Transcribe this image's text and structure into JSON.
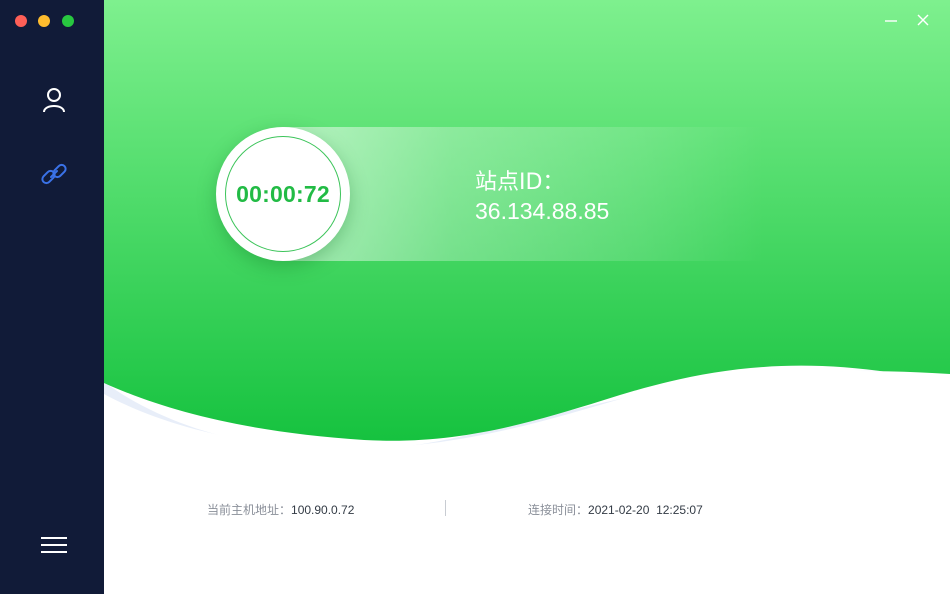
{
  "window": {
    "traffic_lights": {
      "close": "#fe5f57",
      "minimize": "#febc2e",
      "zoom": "#28c840"
    },
    "controls": [
      {
        "name": "minimize",
        "icon": "minimize-icon",
        "glyph": "—"
      },
      {
        "name": "close",
        "icon": "close-icon",
        "glyph": "✕"
      }
    ]
  },
  "sidebar": {
    "background": "#111b38",
    "items": [
      {
        "id": "profile",
        "icon": "user-icon",
        "active": false
      },
      {
        "id": "connection",
        "icon": "link-icon",
        "active": true
      }
    ],
    "menu_icon": "hamburger-menu-icon"
  },
  "theme": {
    "accent": "#22bb45",
    "gradient_top": "#7ef08e",
    "gradient_bottom": "#16c23f",
    "active_icon": "#3a72e8"
  },
  "timer": {
    "value": "00:00:72"
  },
  "site": {
    "label": "站点ID：",
    "value": "36.134.88.85"
  },
  "info": {
    "host_label": "当前主机地址：",
    "host_value": "100.90.0.72",
    "time_label": "连接时间：",
    "time_value": "2021-02-20  12:25:07"
  }
}
